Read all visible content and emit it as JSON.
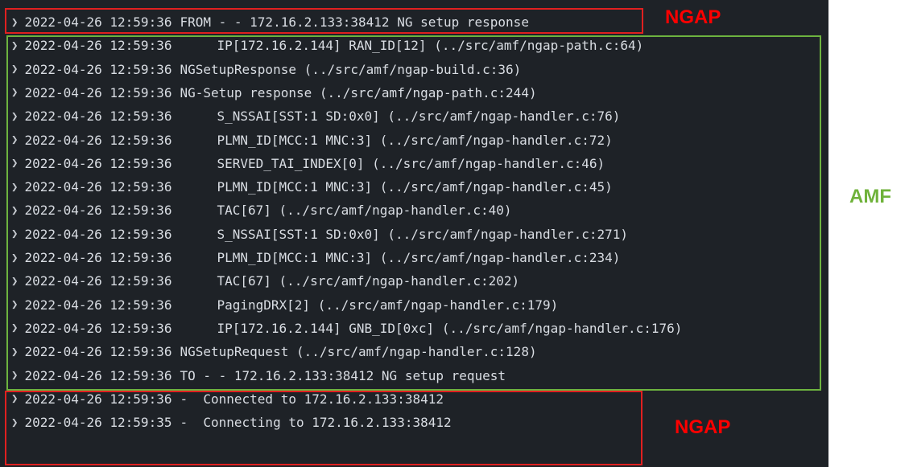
{
  "labels": {
    "ngap_top": "NGAP",
    "amf": "AMF",
    "ngap_bottom": "NGAP"
  },
  "colors": {
    "terminal_bg": "#1e2227",
    "ngap_box": "#e02020",
    "amf_box": "#6db33f"
  },
  "log": [
    {
      "ts": "2022-04-26 12:59:36",
      "indented": false,
      "msg": "FROM - - 172.16.2.133:38412 NG setup response"
    },
    {
      "ts": "2022-04-26 12:59:36",
      "indented": true,
      "msg": "IP[172.16.2.144] RAN_ID[12] (../src/amf/ngap-path.c:64)"
    },
    {
      "ts": "2022-04-26 12:59:36",
      "indented": false,
      "msg": "NGSetupResponse (../src/amf/ngap-build.c:36)"
    },
    {
      "ts": "2022-04-26 12:59:36",
      "indented": false,
      "msg": "NG-Setup response (../src/amf/ngap-path.c:244)"
    },
    {
      "ts": "2022-04-26 12:59:36",
      "indented": true,
      "msg": "S_NSSAI[SST:1 SD:0x0] (../src/amf/ngap-handler.c:76)"
    },
    {
      "ts": "2022-04-26 12:59:36",
      "indented": true,
      "msg": "PLMN_ID[MCC:1 MNC:3] (../src/amf/ngap-handler.c:72)"
    },
    {
      "ts": "2022-04-26 12:59:36",
      "indented": true,
      "msg": "SERVED_TAI_INDEX[0] (../src/amf/ngap-handler.c:46)"
    },
    {
      "ts": "2022-04-26 12:59:36",
      "indented": true,
      "msg": "PLMN_ID[MCC:1 MNC:3] (../src/amf/ngap-handler.c:45)"
    },
    {
      "ts": "2022-04-26 12:59:36",
      "indented": true,
      "msg": "TAC[67] (../src/amf/ngap-handler.c:40)"
    },
    {
      "ts": "2022-04-26 12:59:36",
      "indented": true,
      "msg": "S_NSSAI[SST:1 SD:0x0] (../src/amf/ngap-handler.c:271)"
    },
    {
      "ts": "2022-04-26 12:59:36",
      "indented": true,
      "msg": "PLMN_ID[MCC:1 MNC:3] (../src/amf/ngap-handler.c:234)"
    },
    {
      "ts": "2022-04-26 12:59:36",
      "indented": true,
      "msg": "TAC[67] (../src/amf/ngap-handler.c:202)"
    },
    {
      "ts": "2022-04-26 12:59:36",
      "indented": true,
      "msg": "PagingDRX[2] (../src/amf/ngap-handler.c:179)"
    },
    {
      "ts": "2022-04-26 12:59:36",
      "indented": true,
      "msg": "IP[172.16.2.144] GNB_ID[0xc] (../src/amf/ngap-handler.c:176)"
    },
    {
      "ts": "2022-04-26 12:59:36",
      "indented": false,
      "msg": "NGSetupRequest (../src/amf/ngap-handler.c:128)"
    },
    {
      "ts": "2022-04-26 12:59:36",
      "indented": false,
      "msg": "TO - - 172.16.2.133:38412 NG setup request"
    },
    {
      "ts": "2022-04-26 12:59:36",
      "indented": false,
      "msg": "-  Connected to 172.16.2.133:38412"
    },
    {
      "ts": "2022-04-26 12:59:35",
      "indented": false,
      "msg": "-  Connecting to 172.16.2.133:38412"
    }
  ]
}
